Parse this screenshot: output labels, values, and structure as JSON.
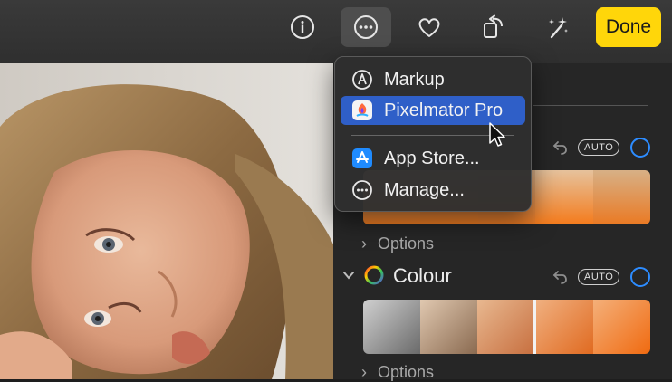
{
  "toolbar": {
    "icons": [
      "info-icon",
      "more-options-icon",
      "favorite-heart-icon",
      "rotate-icon",
      "auto-enhance-magic-wand-icon"
    ],
    "done_label": "Done",
    "accent_color": "#ffd60a"
  },
  "menu": {
    "items": [
      {
        "label": "Markup",
        "icon": "markup-icon"
      },
      {
        "label": "Pixelmator Pro",
        "icon": "pixelmator-pro-app-icon",
        "highlighted": true
      },
      {
        "label": "App Store...",
        "icon": "app-store-icon"
      },
      {
        "label": "Manage...",
        "icon": "manage-more-icon"
      }
    ],
    "highlight_color": "#2f5fc8"
  },
  "panel": {
    "light": {
      "auto_label": "AUTO",
      "options_label": "Options"
    },
    "colour": {
      "title": "Colour",
      "auto_label": "AUTO",
      "options_label": "Options"
    },
    "toggle_color": "#2d8cff"
  }
}
